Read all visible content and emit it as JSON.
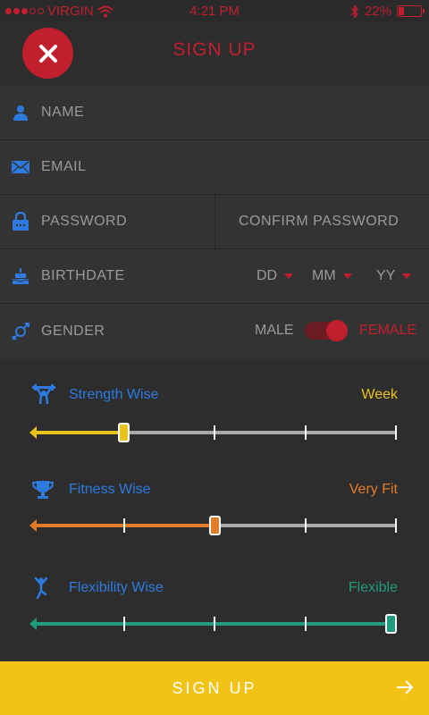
{
  "status_bar": {
    "carrier": "VIRGIN",
    "time": "4:21 PM",
    "battery": "22%",
    "battery_level": 0.22,
    "signal_filled": 3,
    "signal_total": 5
  },
  "header": {
    "title": "SIGN UP",
    "close_icon": "close-icon"
  },
  "form": {
    "name_placeholder": "NAME",
    "email_placeholder": "EMAIL",
    "password_placeholder": "PASSWORD",
    "confirm_password_placeholder": "CONFIRM PASSWORD",
    "birthdate_label": "BIRTHDATE",
    "day": "DD",
    "month": "MM",
    "year": "YY",
    "gender_label": "GENDER",
    "gender_male": "MALE",
    "gender_female": "FEMALE",
    "gender_selected": "FEMALE"
  },
  "sliders": [
    {
      "name": "Strength Wise",
      "value_label": "Week",
      "value": 0.25,
      "color": "#e9c21b",
      "icon": "weightlifter-icon"
    },
    {
      "name": "Fitness Wise",
      "value_label": "Very Fit",
      "value": 0.5,
      "color": "#e37b27",
      "icon": "trophy-icon"
    },
    {
      "name": "Flexibility Wise",
      "value_label": "Flexible",
      "value": 1.0,
      "color": "#1f9b7d",
      "icon": "stretching-icon"
    }
  ],
  "footer": {
    "signup_label": "SIGN UP",
    "arrow_icon": "arrow-right-icon"
  },
  "colors": {
    "accent": "#c21f2e",
    "blue": "#2d7be0",
    "button": "#f2c314",
    "background": "#2d2d2d",
    "row": "#333333"
  }
}
